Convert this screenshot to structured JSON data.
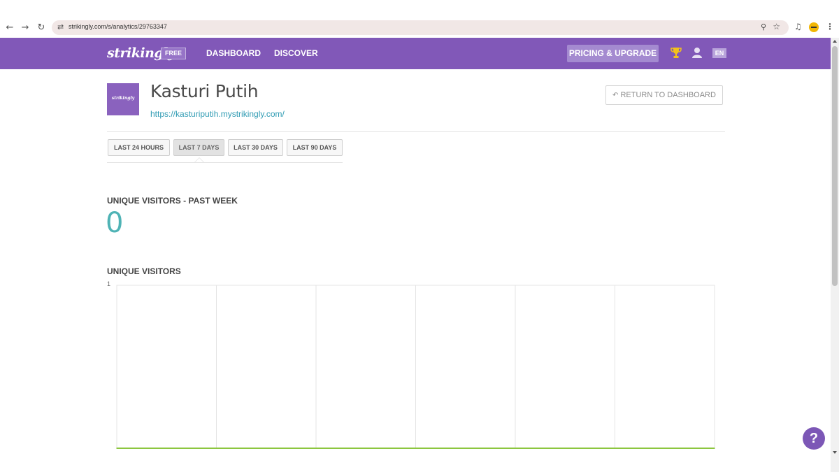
{
  "browser": {
    "url": "strikingly.com/s/analytics/29763347",
    "back_icon": "arrow-left-icon",
    "forward_icon": "arrow-right-icon",
    "reload_icon": "reload-icon"
  },
  "header": {
    "logo": "strikingly",
    "plan_badge": "FREE",
    "nav": [
      "DASHBOARD",
      "DISCOVER"
    ],
    "upgrade_label": "PRICING & UPGRADE",
    "language": "EN",
    "brand_color": "#8158b8"
  },
  "site": {
    "thumb_text": "strikingly",
    "name": "Kasturi Putih",
    "url": "https://kasturiputih.mystrikingly.com/",
    "return_label": "RETURN TO DASHBOARD"
  },
  "ranges": {
    "tabs": [
      "LAST 24 HOURS",
      "LAST 7 DAYS",
      "LAST 30 DAYS",
      "LAST 90 DAYS"
    ],
    "selected": "LAST 7 DAYS"
  },
  "stats": {
    "unique_past_week_label": "UNIQUE VISITORS - PAST WEEK",
    "unique_past_week_value": "0",
    "chart_heading": "UNIQUE VISITORS"
  },
  "chart_data": {
    "type": "line",
    "title": "UNIQUE VISITORS",
    "x": [
      1,
      2,
      3,
      4,
      5,
      6,
      7
    ],
    "series": [
      {
        "values": [
          0,
          0,
          0,
          0,
          0,
          0,
          0
        ],
        "color": "#8cc63f"
      }
    ],
    "yticks": [
      "1"
    ],
    "ylim": [
      0,
      1
    ],
    "grid": true
  },
  "help": {
    "label": "?"
  }
}
